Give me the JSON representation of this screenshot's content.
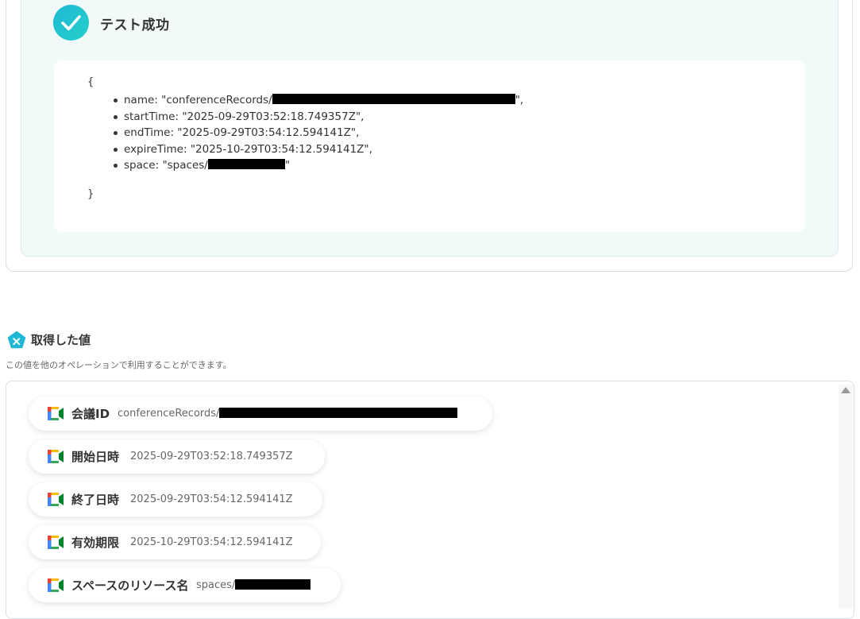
{
  "test_result": {
    "title": "テスト成功",
    "open_brace": "{",
    "close_brace": "}",
    "fields": [
      {
        "text": "name: \"conferenceRecords/",
        "suffix": "\","
      },
      {
        "text": "startTime: \"2025-09-29T03:52:18.749357Z\","
      },
      {
        "text": "endTime: \"2025-09-29T03:54:12.594141Z\","
      },
      {
        "text": "expireTime: \"2025-10-29T03:54:12.594141Z\","
      },
      {
        "text": "space: \"spaces/",
        "suffix": "\""
      }
    ]
  },
  "values_section": {
    "title": "取得した値",
    "description": "この値を他のオペレーションで利用することができます。",
    "items": [
      {
        "label": "会議ID",
        "value": "conferenceRecords/"
      },
      {
        "label": "開始日時",
        "value": "2025-09-29T03:52:18.749357Z"
      },
      {
        "label": "終了日時",
        "value": "2025-09-29T03:54:12.594141Z"
      },
      {
        "label": "有効期限",
        "value": "2025-10-29T03:54:12.594141Z"
      },
      {
        "label": "スペースのリソース名",
        "value": "spaces/"
      }
    ]
  },
  "icons": {
    "success": "check-circle-icon",
    "values": "variable-pentagon-icon",
    "item": "google-meet-icon"
  },
  "colors": {
    "accent": "#1fb8d6",
    "panel_bg": "#f1f9f9",
    "redaction": "#000000"
  }
}
